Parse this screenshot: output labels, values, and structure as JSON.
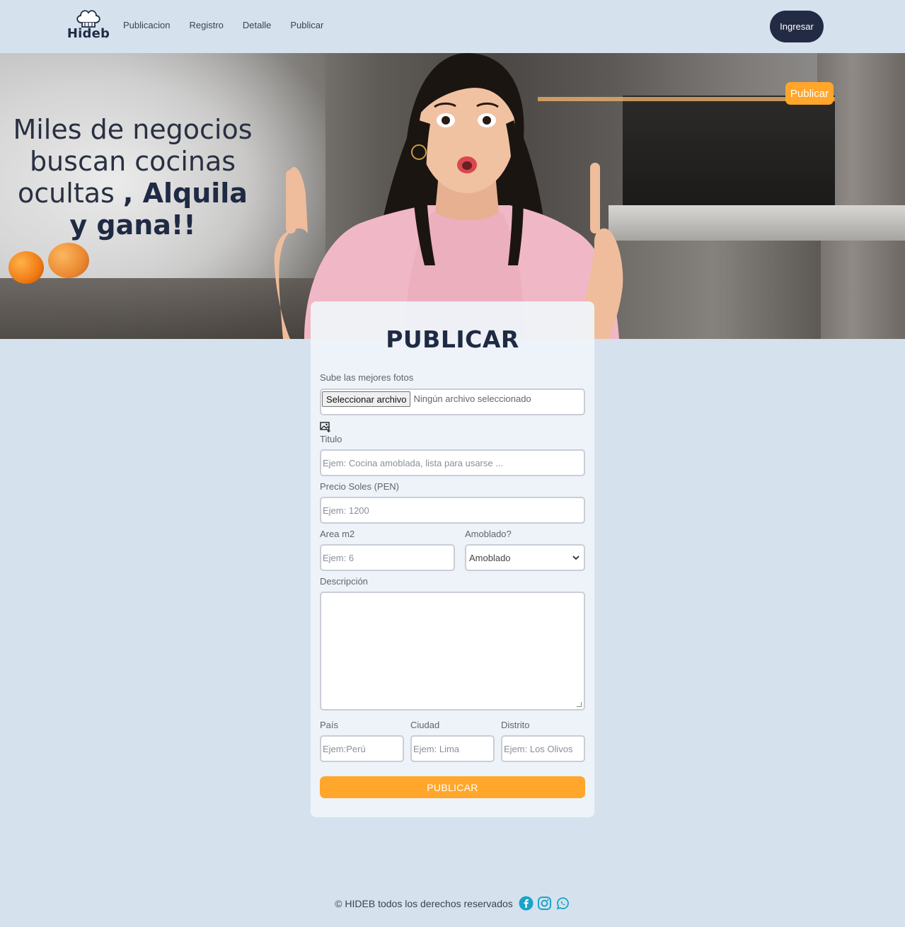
{
  "brand": {
    "name": "Hideb"
  },
  "nav": {
    "links": [
      "Publicacion",
      "Registro",
      "Detalle",
      "Publicar"
    ],
    "login_label": "Ingresar"
  },
  "hero": {
    "title_regular": "Miles de negocios buscan cocinas ocultas",
    "title_bold": ", Alquila y gana!!",
    "publicar_label": "Publicar"
  },
  "form": {
    "title": "PUBLICAR",
    "photos_label": "Sube las mejores fotos",
    "file_button": "Seleccionar archivo",
    "file_status": "Ningún archivo seleccionado",
    "title_label": "Titulo",
    "title_placeholder": "Ejem: Cocina amoblada, lista para usarse ...",
    "price_label": "Precio Soles (PEN)",
    "price_placeholder": "Ejem: 1200",
    "area_label": "Area m2",
    "area_placeholder": "Ejem: 6",
    "furnished_label": "Amoblado?",
    "furnished_value": "Amoblado",
    "description_label": "Descripción",
    "country_label": "País",
    "country_placeholder": "Ejem:Perú",
    "city_label": "Ciudad",
    "city_placeholder": "Ejem: Lima",
    "district_label": "Distrito",
    "district_placeholder": "Ejem: Los Olivos",
    "submit_label": "PUBLICAR"
  },
  "footer": {
    "copyright": "© HIDEB todos los derechos reservados",
    "social_icons": [
      "facebook-icon",
      "instagram-icon",
      "whatsapp-icon"
    ]
  },
  "colors": {
    "background": "#d5e2ee",
    "accent": "#ffa62b",
    "dark": "#232b44",
    "social": "#1aa3c9"
  }
}
